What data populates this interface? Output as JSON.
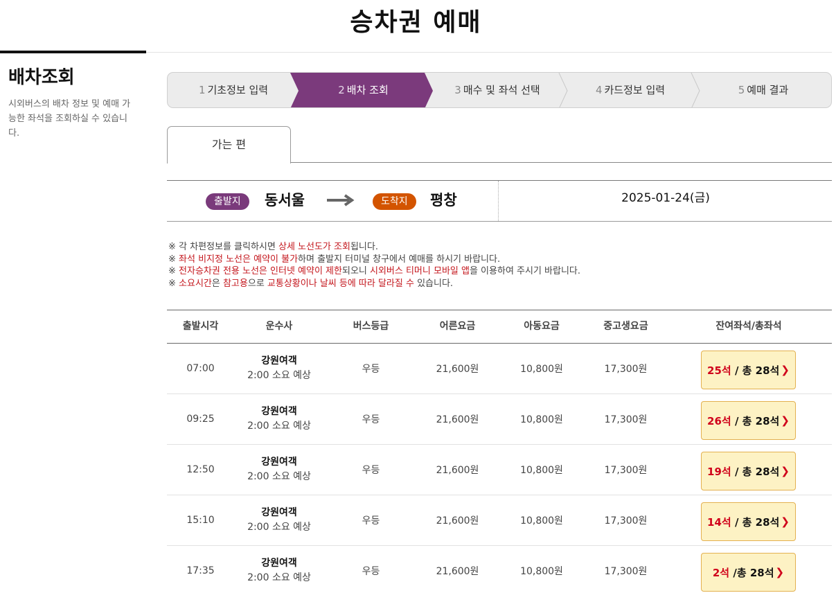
{
  "page": {
    "title": "승차권 예매"
  },
  "side": {
    "title": "배차조회",
    "description": "시외버스의 배차 정보 및 예매 가능한 좌석을 조회하실 수 있습니다."
  },
  "steps": [
    {
      "num": "1",
      "label": "기초정보 입력",
      "active": false
    },
    {
      "num": "2",
      "label": "배차 조회",
      "active": true
    },
    {
      "num": "3",
      "label": "매수 및 좌석 선택",
      "active": false
    },
    {
      "num": "4",
      "label": "카드정보 입력",
      "active": false
    },
    {
      "num": "5",
      "label": "예매 결과",
      "active": false
    }
  ],
  "colors": {
    "active_step": "#7b3a7c",
    "departure_pill": "#7a3a7b",
    "arrival_pill": "#d35400",
    "highlight": "#c4161c"
  },
  "tab": {
    "label": "가는 편"
  },
  "route": {
    "departure_label": "출발지",
    "departure_city": "동서울",
    "arrival_label": "도착지",
    "arrival_city": "평창",
    "date": "2025-01-24(금)"
  },
  "notes": [
    {
      "parts": [
        {
          "t": "※ 각 차편정보를 클릭하시면 ",
          "c": "n"
        },
        {
          "t": "상세 노선도가 조회",
          "c": "h"
        },
        {
          "t": "됩니다.",
          "c": "n"
        }
      ]
    },
    {
      "parts": [
        {
          "t": "※ ",
          "c": "n"
        },
        {
          "t": "좌석 비지정 노선은 예약이 불가",
          "c": "h"
        },
        {
          "t": "하며 출발지 터미널 창구에서 예매를 하시기 바랍니다.",
          "c": "n"
        }
      ]
    },
    {
      "parts": [
        {
          "t": "※ ",
          "c": "n"
        },
        {
          "t": "전자승차권 전용 노선은 인터넷 예약이 제한",
          "c": "h"
        },
        {
          "t": "되오니 ",
          "c": "n"
        },
        {
          "t": "시외버스 티머니 모바일 앱",
          "c": "h"
        },
        {
          "t": "을 이용하여 주시기 바랍니다.",
          "c": "n"
        }
      ]
    },
    {
      "parts": [
        {
          "t": "※ ",
          "c": "n"
        },
        {
          "t": "소요시간",
          "c": "h"
        },
        {
          "t": "은 ",
          "c": "n"
        },
        {
          "t": "참고용",
          "c": "h"
        },
        {
          "t": "으로 ",
          "c": "n"
        },
        {
          "t": "교통상황이나 날씨 등에 따라 달라질 수",
          "c": "h"
        },
        {
          "t": " 있습니다.",
          "c": "n"
        }
      ]
    }
  ],
  "table": {
    "headers": [
      "출발시각",
      "운수사",
      "버스등급",
      "어른요금",
      "아동요금",
      "중고생요금",
      "잔여좌석/총좌석"
    ],
    "rows": [
      {
        "time": "07:00",
        "company": "강원여객",
        "duration": "2:00 소요 예상",
        "grade": "우등",
        "adult": "21,600원",
        "child": "10,800원",
        "youth": "17,300원",
        "remaining": "25석",
        "total": " / 총 28석"
      },
      {
        "time": "09:25",
        "company": "강원여객",
        "duration": "2:00 소요 예상",
        "grade": "우등",
        "adult": "21,600원",
        "child": "10,800원",
        "youth": "17,300원",
        "remaining": "26석",
        "total": " / 총 28석"
      },
      {
        "time": "12:50",
        "company": "강원여객",
        "duration": "2:00 소요 예상",
        "grade": "우등",
        "adult": "21,600원",
        "child": "10,800원",
        "youth": "17,300원",
        "remaining": "19석",
        "total": " / 총 28석"
      },
      {
        "time": "15:10",
        "company": "강원여객",
        "duration": "2:00 소요 예상",
        "grade": "우등",
        "adult": "21,600원",
        "child": "10,800원",
        "youth": "17,300원",
        "remaining": "14석",
        "total": " / 총 28석"
      },
      {
        "time": "17:35",
        "company": "강원여객",
        "duration": "2:00 소요 예상",
        "grade": "우등",
        "adult": "21,600원",
        "child": "10,800원",
        "youth": "17,300원",
        "remaining": "2석",
        "total": " /총 28석"
      }
    ]
  }
}
